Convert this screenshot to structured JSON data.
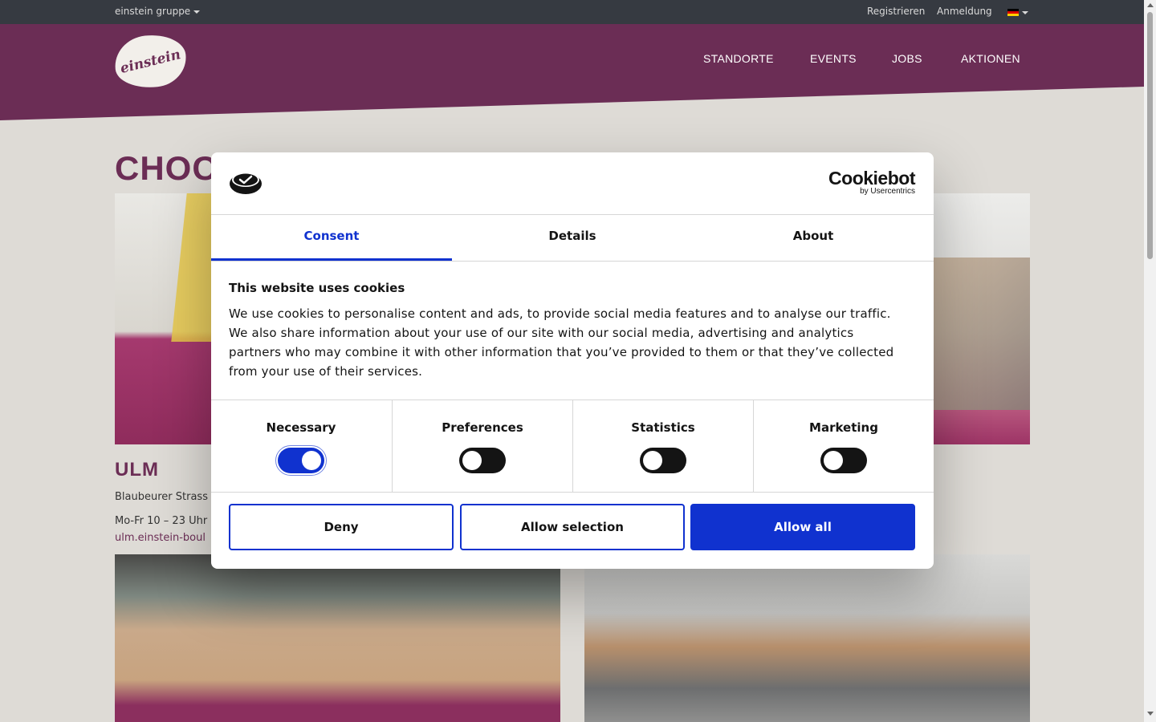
{
  "topbar": {
    "group_label": "einstein gruppe",
    "register": "Registrieren",
    "login": "Anmeldung",
    "language_flag": "de-flag-icon"
  },
  "header": {
    "logo_text": "einstein",
    "nav": [
      "STANDORTE",
      "EVENTS",
      "JOBS",
      "AKTIONEN"
    ]
  },
  "content": {
    "page_title_visible": "CHOC",
    "location": {
      "city": "ULM",
      "address_visible": "Blaubeurer Strass",
      "hours_visible": "Mo-Fr 10 – 23 Uhr",
      "url_visible": "ulm.einstein-boul"
    }
  },
  "cookie_dialog": {
    "brand": "Cookiebot",
    "brand_sub": "by Usercentrics",
    "tabs": [
      "Consent",
      "Details",
      "About"
    ],
    "active_tab": "Consent",
    "title": "This website uses cookies",
    "body": "We use cookies to personalise content and ads, to provide social media features and to analyse our traffic. We also share information about your use of our site with our social media, advertising and analytics partners who may combine it with other information that you’ve provided to them or that they’ve collected from your use of their services.",
    "categories": [
      {
        "label": "Necessary",
        "enabled": true
      },
      {
        "label": "Preferences",
        "enabled": false
      },
      {
        "label": "Statistics",
        "enabled": false
      },
      {
        "label": "Marketing",
        "enabled": false
      }
    ],
    "buttons": {
      "deny": "Deny",
      "allow_selection": "Allow selection",
      "allow_all": "Allow all"
    },
    "accent_color": "#1032cf"
  },
  "colors": {
    "brand": "#6b2d55",
    "topbar": "#363a41",
    "page_bg": "#dedbd6"
  }
}
